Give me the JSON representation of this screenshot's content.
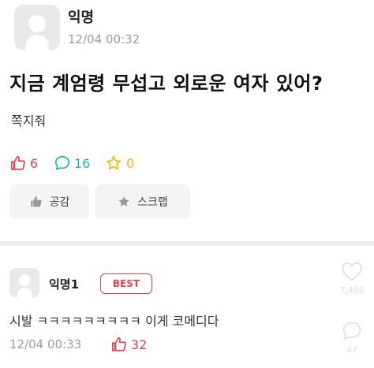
{
  "post": {
    "author": "익명",
    "timestamp": "12/04 00:32",
    "title": "지금 계엄령 무섭고 외로운 여자 있어?",
    "body": "쪽지줘",
    "likes": "6",
    "comments": "16",
    "scraps": "0",
    "like_button": "공감",
    "scrap_button": "스크랩"
  },
  "comment": {
    "author": "익명1",
    "badge": "BEST",
    "text": "시발 ㅋㅋㅋㅋㅋㅋㅋㅋㅋ 이게 코메디다",
    "timestamp": "12/04 00:33",
    "likes": "32"
  },
  "side_overlay": {
    "like_count": "7,406",
    "comment_count": "47"
  },
  "colors": {
    "like_red": "#e4434f",
    "comment_teal": "#16b5b5",
    "scrap_yellow": "#f2b800"
  }
}
